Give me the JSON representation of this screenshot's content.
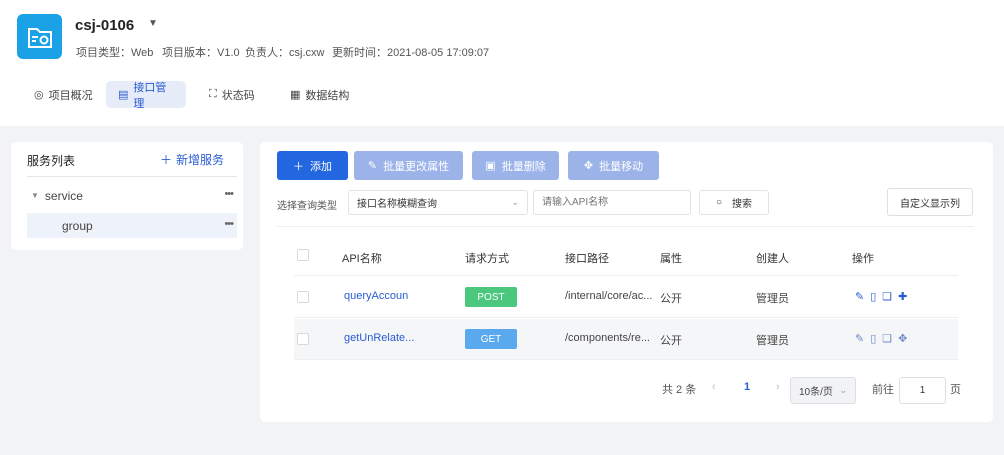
{
  "header": {
    "project_name": "csj-0106",
    "meta": {
      "type": "项目类型：Web",
      "version": "项目版本：V1.0",
      "owner": "负责人：csj.cxw",
      "updated": "更新时间：2021-08-05 17:09:07"
    },
    "tabs": [
      {
        "label": "项目概况",
        "icon": "overview-icon",
        "active": false
      },
      {
        "label": "接口管理",
        "icon": "interface-icon",
        "active": true
      },
      {
        "label": "状态码",
        "icon": "status-code-icon",
        "active": false
      },
      {
        "label": "数据结构",
        "icon": "data-structure-icon",
        "active": false
      }
    ]
  },
  "sidebar": {
    "title": "服务列表",
    "add_label": "新增服务",
    "tree": [
      {
        "label": "service",
        "level": 0,
        "selected": false
      },
      {
        "label": "group",
        "level": 1,
        "selected": true
      }
    ]
  },
  "toolbar": {
    "add": "添加",
    "batch_edit": "批量更改属性",
    "batch_delete": "批量删除",
    "batch_move": "批量移动"
  },
  "filter": {
    "label": "选择查询类型",
    "select_value": "接口名称模糊查询",
    "search_placeholder": "请输入API名称",
    "search_button": "搜索",
    "custom_columns": "自定义显示列"
  },
  "table": {
    "headers": [
      "API名称",
      "请求方式",
      "接口路径",
      "属性",
      "创建人",
      "操作"
    ],
    "rows": [
      {
        "name": "queryAccoun",
        "method": "POST",
        "method_color": "#4cc77e",
        "path": "/internal/core/ac...",
        "attr": "公开",
        "creator": "管理员"
      },
      {
        "name": "getUnRelate...",
        "method": "GET",
        "method_color": "#5aa8ee",
        "path": "/components/re...",
        "attr": "公开",
        "creator": "管理员"
      }
    ]
  },
  "pagination": {
    "total": "共 2 条",
    "current_page": "1",
    "page_size": "10条/页",
    "goto_prefix": "前往",
    "goto_value": "1",
    "goto_suffix": "页"
  },
  "colors": {
    "primary": "#2266e0",
    "primary_light": "#9bb3e8",
    "logo": "#1ba2e6"
  }
}
